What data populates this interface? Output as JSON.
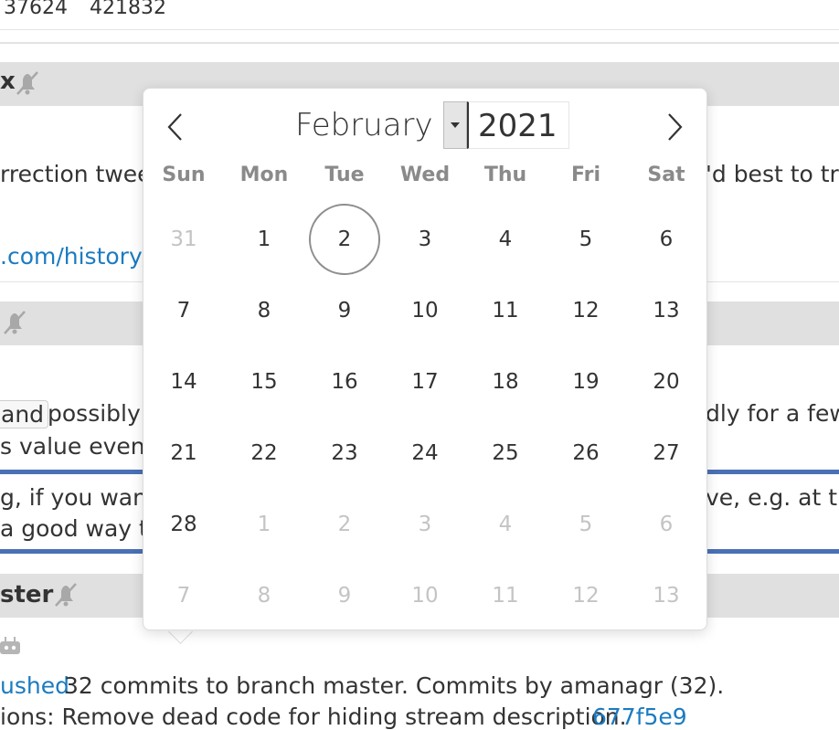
{
  "background": {
    "top_numbers": [
      "37624",
      "421832"
    ],
    "topic1": {
      "heading_fragment": "x",
      "line1_left": "rrection twee",
      "line1_right": "'d best to try",
      "link_text": ".com/history/"
    },
    "topic2": {
      "line1_left_pill": "and",
      "line1_left": "possibly!",
      "line1_right": "dly for a few",
      "line2_left": "s value even c",
      "line3_left": "g, if you want",
      "line3_right": "ve, e.g. at the",
      "line4_left": "a good way to"
    },
    "topic3": {
      "heading": "ster",
      "pushed_link": "ushed",
      "pushed_text": "32 commits to branch master. Commits by amanagr (32).",
      "last_line": "ions: Remove dead code for hiding stream description.",
      "commit_link": "677f5e9"
    }
  },
  "datepicker": {
    "month": "February",
    "year": "2021",
    "weekdays": [
      "Sun",
      "Mon",
      "Tue",
      "Wed",
      "Thu",
      "Fri",
      "Sat"
    ],
    "weeks": [
      [
        {
          "d": "31",
          "o": true
        },
        {
          "d": "1"
        },
        {
          "d": "2",
          "today": true
        },
        {
          "d": "3"
        },
        {
          "d": "4"
        },
        {
          "d": "5"
        },
        {
          "d": "6"
        }
      ],
      [
        {
          "d": "7"
        },
        {
          "d": "8"
        },
        {
          "d": "9"
        },
        {
          "d": "10"
        },
        {
          "d": "11"
        },
        {
          "d": "12"
        },
        {
          "d": "13"
        }
      ],
      [
        {
          "d": "14"
        },
        {
          "d": "15"
        },
        {
          "d": "16"
        },
        {
          "d": "17"
        },
        {
          "d": "18"
        },
        {
          "d": "19"
        },
        {
          "d": "20"
        }
      ],
      [
        {
          "d": "21"
        },
        {
          "d": "22"
        },
        {
          "d": "23"
        },
        {
          "d": "24"
        },
        {
          "d": "25"
        },
        {
          "d": "26"
        },
        {
          "d": "27"
        }
      ],
      [
        {
          "d": "28"
        },
        {
          "d": "1",
          "o": true
        },
        {
          "d": "2",
          "o": true
        },
        {
          "d": "3",
          "o": true
        },
        {
          "d": "4",
          "o": true
        },
        {
          "d": "5",
          "o": true
        },
        {
          "d": "6",
          "o": true
        }
      ],
      [
        {
          "d": "7",
          "o": true
        },
        {
          "d": "8",
          "o": true
        },
        {
          "d": "9",
          "o": true
        },
        {
          "d": "10",
          "o": true
        },
        {
          "d": "11",
          "o": true
        },
        {
          "d": "12",
          "o": true
        },
        {
          "d": "13",
          "o": true
        }
      ]
    ]
  }
}
